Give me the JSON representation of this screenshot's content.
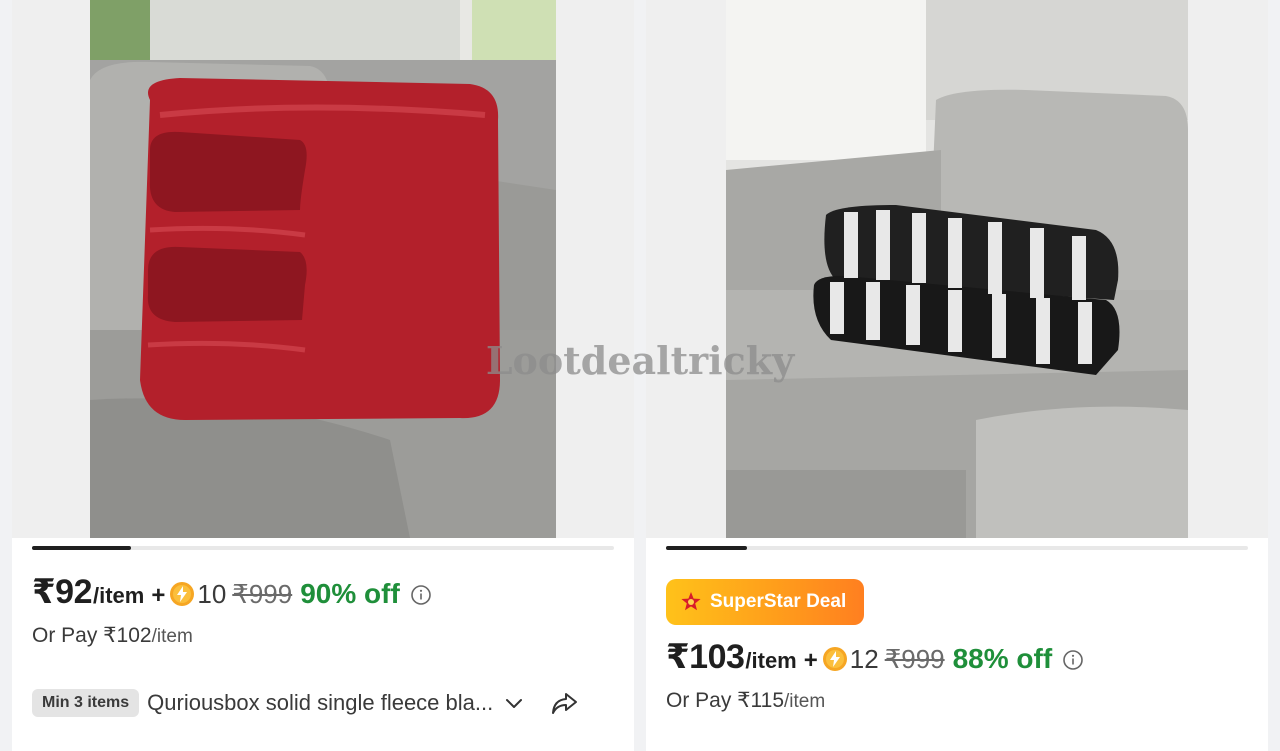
{
  "watermark": "Lootdealtricky",
  "products": [
    {
      "price": "₹92",
      "per_item": "/item",
      "plus": "+",
      "coins": "10",
      "mrp": "₹999",
      "discount": "90% off",
      "alt_pay_prefix": "Or Pay ₹102",
      "alt_pay_unit": "/item",
      "min_items": "Min 3 items",
      "title": "Quriousbox solid single fleece bla...",
      "image_progress": 0.17,
      "blanket_color": "#b3202b"
    },
    {
      "badge": "SuperStar Deal",
      "price": "₹103",
      "per_item": "/item",
      "plus": "+",
      "coins": "12",
      "mrp": "₹999",
      "discount": "88% off",
      "alt_pay_prefix": "Or Pay ₹115",
      "alt_pay_unit": "/item",
      "image_progress": 0.14
    }
  ],
  "colors": {
    "discount_green": "#1f8f3a",
    "badge_orange": "#ff9e1b",
    "coin_gold": "#f6a623"
  },
  "icons": [
    "coin-icon",
    "info-icon",
    "chevron-down-icon",
    "share-icon",
    "superstar-icon"
  ]
}
